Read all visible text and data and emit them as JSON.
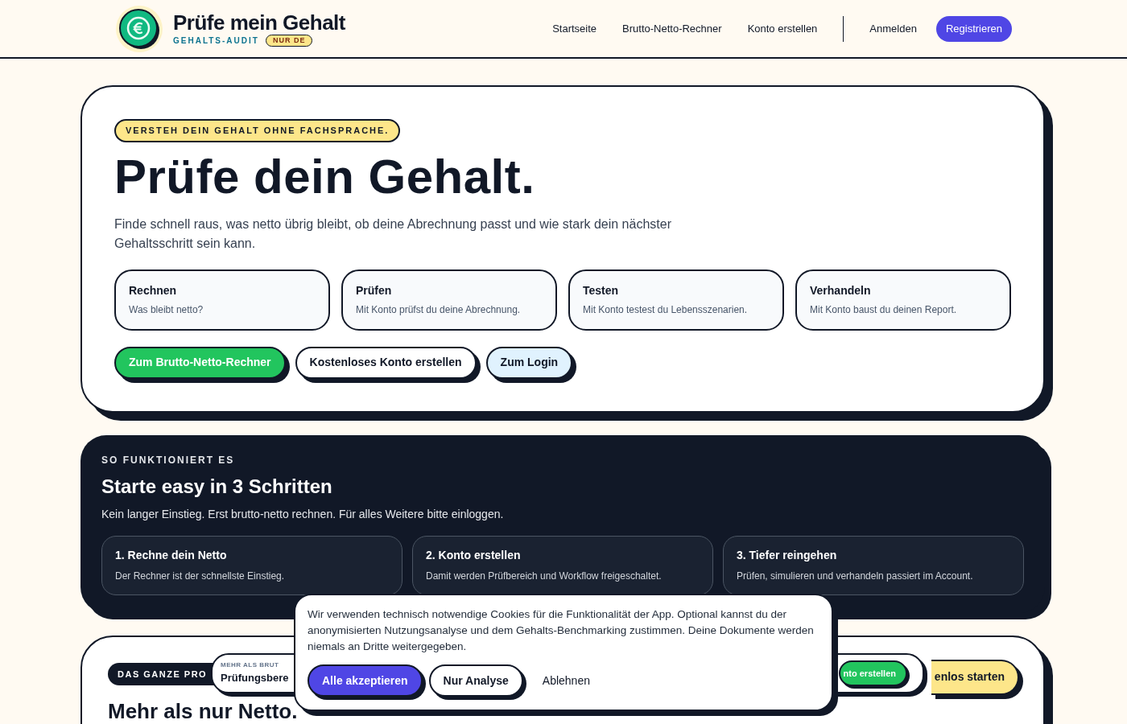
{
  "header": {
    "logo_title": "Prüfe mein Gehalt",
    "logo_subtitle": "GEHALTS-AUDIT",
    "logo_badge": "NUR DE",
    "nav": [
      {
        "label": "Startseite"
      },
      {
        "label": "Brutto-Netto-Rechner"
      },
      {
        "label": "Konto erstellen"
      }
    ],
    "login": "Anmelden",
    "register": "Registrieren"
  },
  "hero": {
    "badge": "VERSTEH DEIN GEHALT OHNE FACHSPRACHE.",
    "title": "Prüfe dein Gehalt.",
    "text": "Finde schnell raus, was netto übrig bleibt, ob deine Abrechnung passt und wie stark dein nächster Gehaltsschritt sein kann.",
    "features": [
      {
        "title": "Rechnen",
        "text": "Was bleibt netto?"
      },
      {
        "title": "Prüfen",
        "text": "Mit Konto prüfst du deine Abrechnung."
      },
      {
        "title": "Testen",
        "text": "Mit Konto testest du Lebensszenarien."
      },
      {
        "title": "Verhandeln",
        "text": "Mit Konto baust du deinen Report."
      }
    ],
    "buttons": [
      {
        "label": "Zum Brutto-Netto-Rechner",
        "kind": "primary"
      },
      {
        "label": "Kostenloses Konto erstellen",
        "kind": "outline"
      },
      {
        "label": "Zum Login",
        "kind": "soft"
      }
    ]
  },
  "steps": {
    "eyebrow": "SO FUNKTIONIERT ES",
    "title": "Starte easy in 3 Schritten",
    "text": "Kein langer Einstieg. Erst brutto-netto rechnen. Für alles Weitere bitte einloggen.",
    "items": [
      {
        "title": "1. Rechne dein Netto",
        "text": "Der Rechner ist der schnellste Einstieg."
      },
      {
        "title": "2. Konto erstellen",
        "text": "Damit werden Prüfbereich und Workflow freigeschaltet."
      },
      {
        "title": "3. Tiefer reingehen",
        "text": "Prüfen, simulieren und verhandeln passiert im Account."
      }
    ]
  },
  "bottom": {
    "badge": "DAS GANZE PRO",
    "title": "Mehr als nur Netto.",
    "button": "enlos starten"
  },
  "floating_bar": {
    "eyebrow": "MEHR ALS BRUT",
    "title": "Prüfungsbere",
    "button": "nto erstellen"
  },
  "cookie": {
    "text": "Wir verwenden technisch notwendige Cookies für die Funktionalität der App. Optional kannst du der anonymisierten Nutzungsanalyse und dem Gehalts-Benchmarking zustimmen. Deine Dokumente werden niemals an Dritte weitergegeben.",
    "buttons": [
      {
        "label": "Alle akzeptieren",
        "kind": "primary"
      },
      {
        "label": "Nur Analyse",
        "kind": "outline"
      },
      {
        "label": "Ablehnen",
        "kind": "plain"
      }
    ]
  }
}
